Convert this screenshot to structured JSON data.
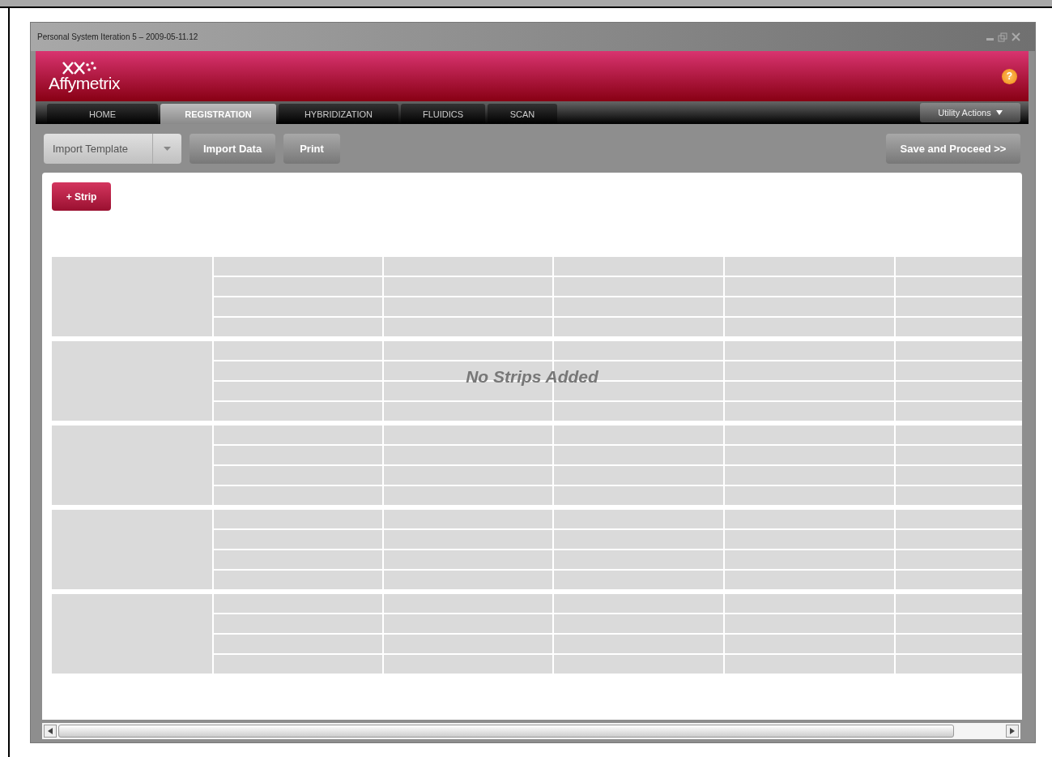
{
  "window": {
    "title": "Personal System Iteration 5 – 2009-05-11.12"
  },
  "header": {
    "logo": "Affymetrix",
    "help": "?"
  },
  "tabs": [
    {
      "label": "HOME",
      "selected": false
    },
    {
      "label": "REGISTRATION",
      "selected": true
    },
    {
      "label": "HYBRIDIZATION",
      "selected": false
    },
    {
      "label": "FLUIDICS",
      "selected": false
    },
    {
      "label": "SCAN",
      "selected": false
    }
  ],
  "utility_menu": {
    "label": "Utility Actions"
  },
  "toolbar": {
    "template_dropdown": "Import Template",
    "buttons": [
      "Import Data",
      "Print"
    ],
    "proceed": "Save and Proceed >>"
  },
  "add_strip_button": "+ Strip",
  "strips": {
    "empty_message": "No Strips Added"
  }
}
